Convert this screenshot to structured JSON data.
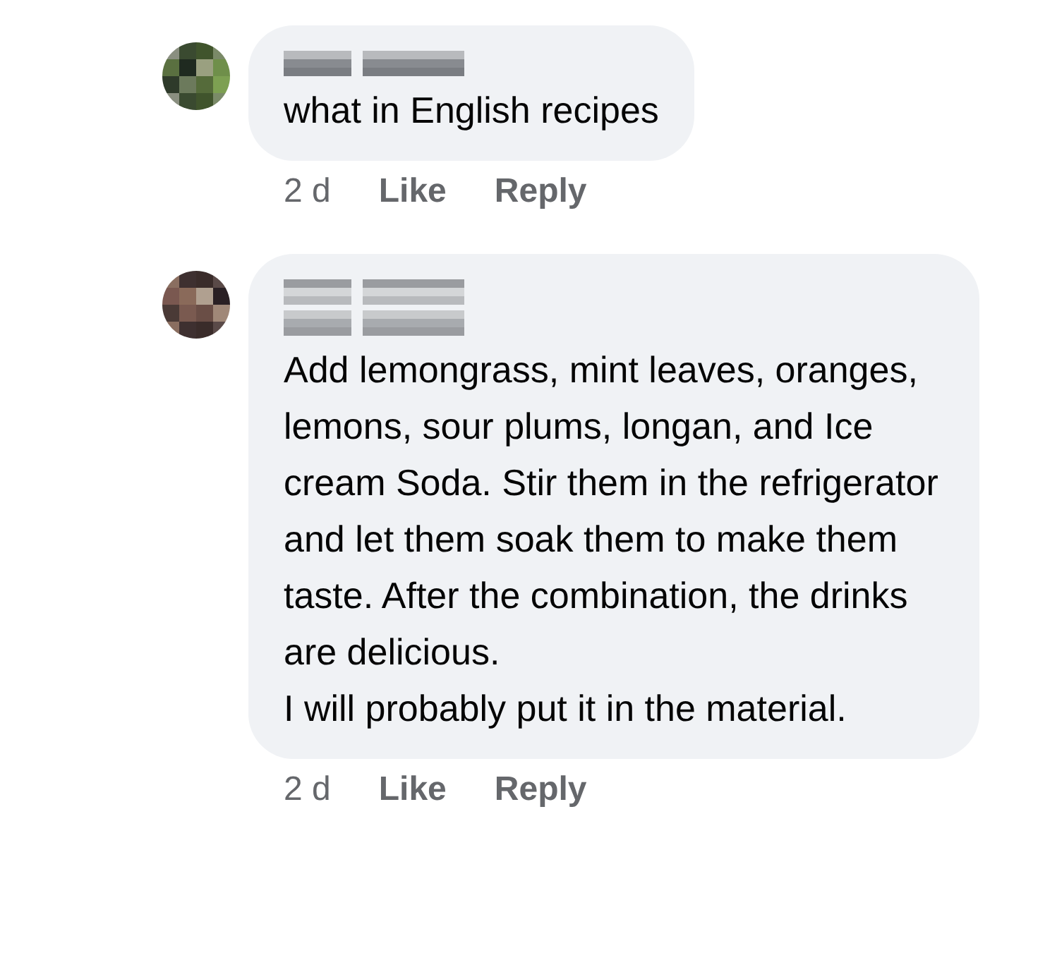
{
  "comments": [
    {
      "avatar": {
        "kind": "picture"
      },
      "header": [
        {
          "kind": "blurred"
        }
      ],
      "paragraphs": [
        "what in English recipes"
      ],
      "time": "2 d",
      "actions": [
        "Like",
        "Reply"
      ]
    },
    {
      "avatar": {
        "kind": "picture"
      },
      "header": [
        {
          "kind": "blurred"
        },
        {
          "kind": "blurred"
        }
      ],
      "paragraphs": [
        "Add lemongrass, mint leaves, oranges, lemons, sour plums, longan, and Ice cream Soda. Stir them in the refrigerator and let them soak them to make them taste. After the combination, the drinks are delicious.",
        "I will probably put it in the material."
      ],
      "time": "2 d",
      "actions": [
        "Like",
        "Reply"
      ]
    }
  ]
}
